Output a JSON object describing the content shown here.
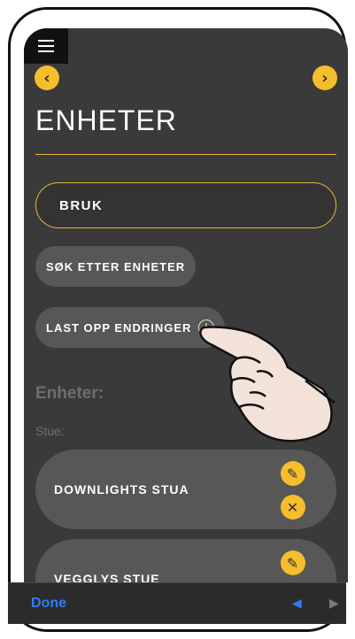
{
  "header": {
    "title": "ENHETER"
  },
  "mode_field": {
    "value": "BRUK"
  },
  "buttons": {
    "search": "SØK ETTER ENHETER",
    "upload": "LAST OPP ENDRINGER"
  },
  "section": {
    "heading": "Enheter:",
    "room": "Stue:"
  },
  "devices": [
    {
      "label": "DOWNLIGHTS STUA"
    },
    {
      "label": "VEGGLYS STUE"
    }
  ],
  "keyboard_bar": {
    "done": "Done"
  },
  "colors": {
    "accent": "#f6be2c",
    "background": "#3a3a3a",
    "button": "#575757",
    "ios_blue": "#3479f6"
  },
  "icons": [
    "menu-icon",
    "back-arrow-icon",
    "forward-arrow-icon",
    "info-icon",
    "pencil-icon",
    "close-icon",
    "pointing-hand"
  ]
}
